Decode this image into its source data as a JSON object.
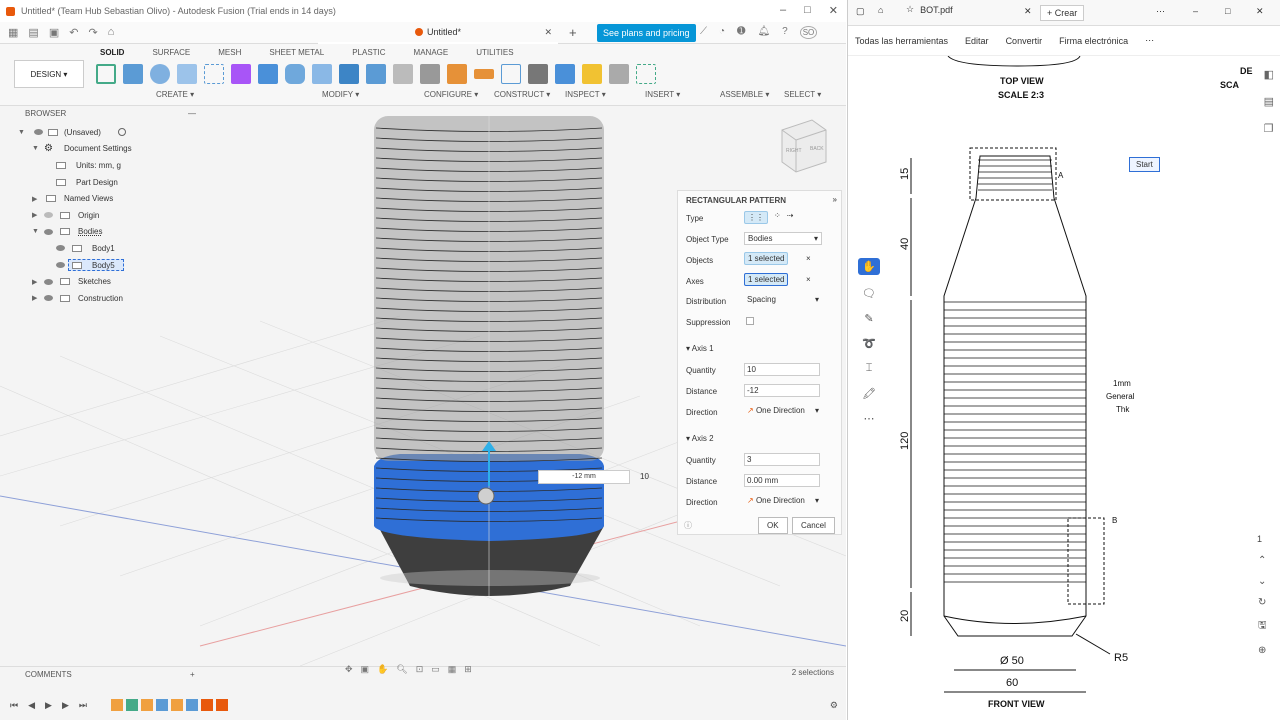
{
  "fusion": {
    "window_title": "Untitled* (Team Hub Sebastian Olivo) - Autodesk Fusion (Trial ends in 14 days)",
    "doc_tab": "Untitled*",
    "pricing_button": "See plans and pricing",
    "user_initials": "SO",
    "tabs": [
      "SOLID",
      "SURFACE",
      "MESH",
      "SHEET METAL",
      "PLASTIC",
      "MANAGE",
      "UTILITIES"
    ],
    "active_tab": "SOLID",
    "design_button": "DESIGN ▾",
    "groups": [
      "CREATE ▾",
      "MODIFY ▾",
      "CONFIGURE ▾",
      "CONSTRUCT ▾",
      "INSPECT ▾",
      "INSERT ▾",
      "ASSEMBLE ▾",
      "SELECT ▾"
    ],
    "browser": {
      "title": "BROWSER",
      "items": [
        {
          "label": "(Unsaved)"
        },
        {
          "label": "Document Settings"
        },
        {
          "label": "Units: mm, g"
        },
        {
          "label": "Part Design"
        },
        {
          "label": "Named Views"
        },
        {
          "label": "Origin"
        },
        {
          "label": "Bodies"
        },
        {
          "label": "Body1"
        },
        {
          "label": "Body5"
        },
        {
          "label": "Sketches"
        },
        {
          "label": "Construction"
        }
      ]
    },
    "viewcube": {
      "right": "RIGHT",
      "back": "BACK"
    },
    "dimension_label": "-12 mm",
    "quantity_label": "10",
    "panel": {
      "title": "RECTANGULAR PATTERN",
      "type_label": "Type",
      "object_type_label": "Object Type",
      "object_type_value": "Bodies",
      "objects_label": "Objects",
      "objects_value": "1 selected",
      "axes_label": "Axes",
      "axes_value": "1 selected",
      "distribution_label": "Distribution",
      "distribution_value": "Spacing",
      "suppression_label": "Suppression",
      "axis1_title": "Axis 1",
      "axis1_quantity_label": "Quantity",
      "axis1_quantity": "10",
      "axis1_distance_label": "Distance",
      "axis1_distance": "-12",
      "axis1_direction_label": "Direction",
      "axis1_direction": "One Direction",
      "axis2_title": "Axis 2",
      "axis2_quantity_label": "Quantity",
      "axis2_quantity": "3",
      "axis2_distance_label": "Distance",
      "axis2_distance": "0.00 mm",
      "axis2_direction_label": "Direction",
      "axis2_direction": "One Direction",
      "ok": "OK",
      "cancel": "Cancel"
    },
    "comments": "COMMENTS",
    "selections": "2 selections"
  },
  "pdf": {
    "tab_title": "BOT.pdf",
    "crear": "Crear",
    "menu": [
      "Todas las herramientas",
      "Editar",
      "Convertir",
      "Firma electrónica"
    ],
    "start_button": "Start",
    "drawing": {
      "top_view": "TOP VIEW",
      "top_scale": "SCALE 2:3",
      "dim_15": "15",
      "dim_40": "40",
      "dim_120": "120",
      "dim_20": "20",
      "note_line1": "1mm",
      "note_line2": "General",
      "note_line3": "Thk",
      "label_a": "A",
      "label_b": "B",
      "dia_50": "Ø 50",
      "dim_60": "60",
      "r5": "R5",
      "front_view": "FRONT VIEW",
      "de": "DE",
      "sca": "SCA"
    },
    "page_number": "1"
  },
  "colors": {
    "accent": "#0696d7",
    "fusion_orange": "#e8590c",
    "body_blue": "#2f6fd6"
  }
}
